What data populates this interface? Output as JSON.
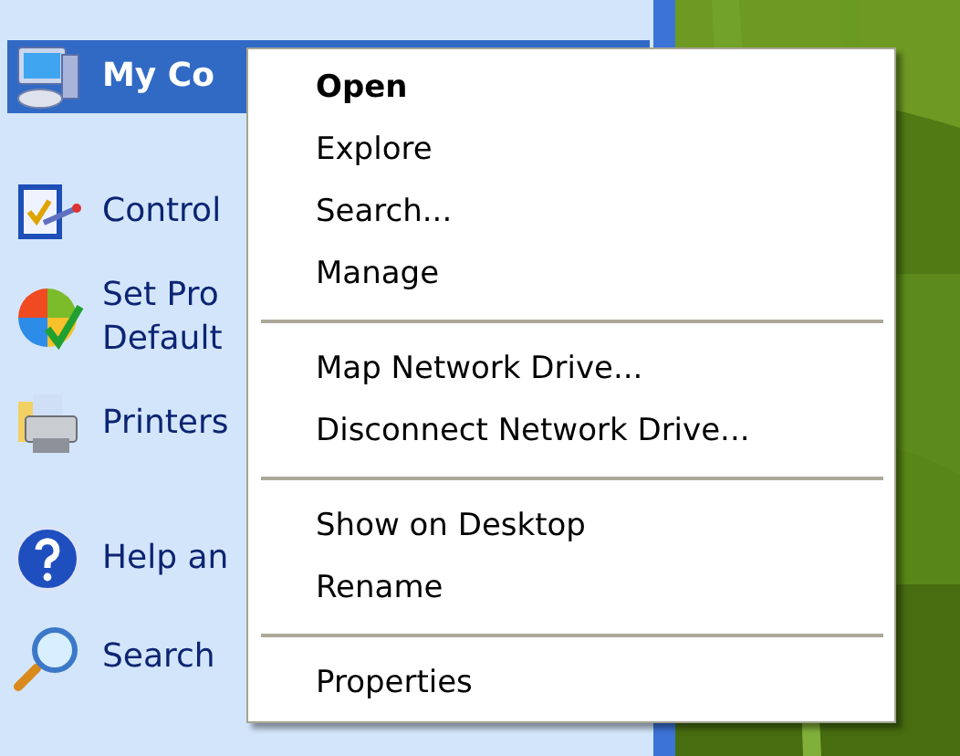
{
  "start_menu": {
    "items": [
      {
        "kind": "item",
        "lines": [
          "My Co"
        ],
        "selected": true
      },
      {
        "kind": "separator"
      },
      {
        "kind": "item",
        "lines": [
          "Control"
        ],
        "selected": false
      },
      {
        "kind": "item",
        "lines": [
          "Set Pro",
          "Default"
        ],
        "selected": false
      },
      {
        "kind": "item",
        "lines": [
          "Printers"
        ],
        "selected": false
      },
      {
        "kind": "separator"
      },
      {
        "kind": "item",
        "lines": [
          "Help an"
        ],
        "selected": false
      },
      {
        "kind": "item",
        "lines": [
          "Search"
        ],
        "selected": false
      }
    ]
  },
  "context_menu": {
    "items": [
      {
        "kind": "item",
        "label": "Open",
        "default": true
      },
      {
        "kind": "item",
        "label": "Explore",
        "default": false
      },
      {
        "kind": "item",
        "label": "Search...",
        "default": false
      },
      {
        "kind": "item",
        "label": "Manage",
        "default": false
      },
      {
        "kind": "separator"
      },
      {
        "kind": "item",
        "label": "Map Network Drive...",
        "default": false
      },
      {
        "kind": "item",
        "label": "Disconnect Network Drive...",
        "default": false
      },
      {
        "kind": "separator"
      },
      {
        "kind": "item",
        "label": "Show on Desktop",
        "default": false
      },
      {
        "kind": "item",
        "label": "Rename",
        "default": false
      },
      {
        "kind": "separator"
      },
      {
        "kind": "item",
        "label": "Properties",
        "default": false
      }
    ]
  }
}
